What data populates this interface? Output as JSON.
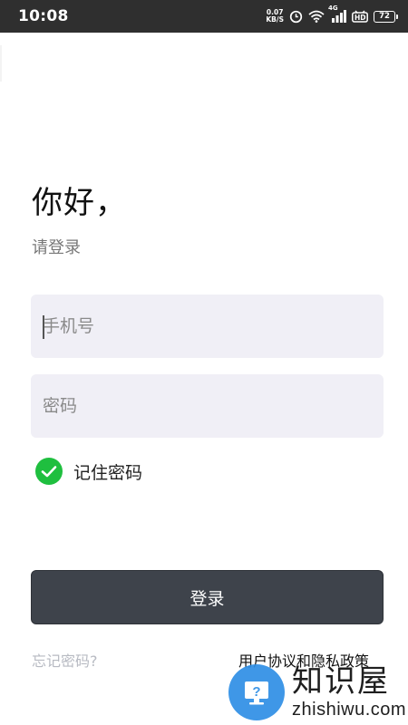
{
  "status_bar": {
    "time": "10:08",
    "net_speed_value": "0.07",
    "net_speed_unit": "KB/S",
    "network_type": "4G",
    "hd_label": "HD",
    "battery_level": "72"
  },
  "greeting": {
    "title": "你好，",
    "subtitle": "请登录"
  },
  "form": {
    "phone_placeholder": "手机号",
    "phone_value": "",
    "password_placeholder": "密码",
    "password_value": "",
    "remember_label": "记住密码",
    "remember_checked": true,
    "login_label": "登录"
  },
  "links": {
    "forgot_password": "忘记密码?",
    "policy": "用户协议和隐私政策"
  },
  "watermark": {
    "cn": "知识屋",
    "en": "zhishiwu.com",
    "reg": "®"
  },
  "colors": {
    "accent_check": "#1fbf3f",
    "button_bg": "#3e434b",
    "field_bg": "#f0eff6",
    "status_bar_bg": "#2f2f2f"
  }
}
